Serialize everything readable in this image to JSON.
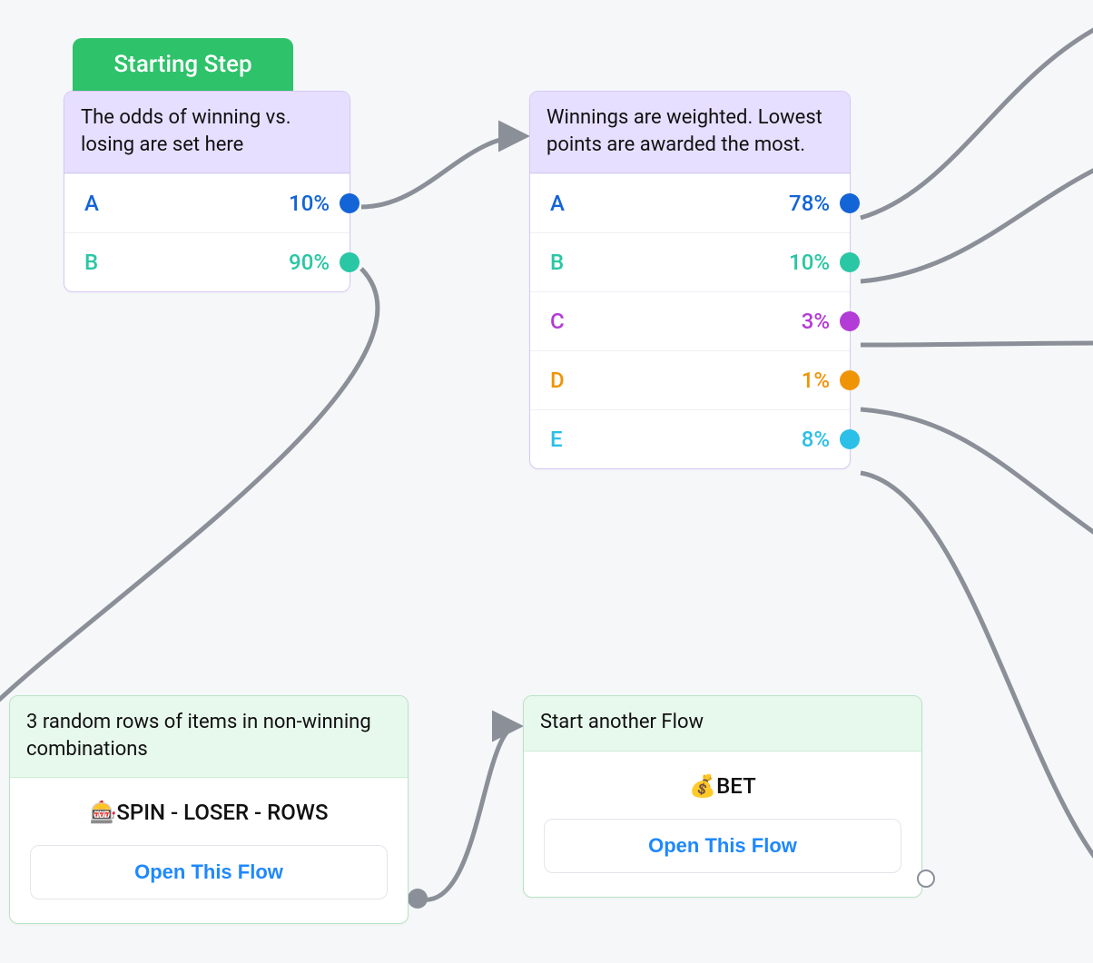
{
  "starting_tab": "Starting Step",
  "node1": {
    "header": "The odds of winning vs. losing are set here",
    "rows": [
      {
        "label": "A",
        "value": "10%",
        "color": "#1364d6"
      },
      {
        "label": "B",
        "value": "90%",
        "color": "#29c7a4"
      }
    ]
  },
  "node2": {
    "header": "Winnings are weighted. Lowest points are awarded the most.",
    "rows": [
      {
        "label": "A",
        "value": "78%",
        "color": "#1364d6"
      },
      {
        "label": "B",
        "value": "10%",
        "color": "#29c7a4"
      },
      {
        "label": "C",
        "value": "3%",
        "color": "#b33bd6"
      },
      {
        "label": "D",
        "value": "1%",
        "color": "#f09407"
      },
      {
        "label": "E",
        "value": "8%",
        "color": "#2cbfe8"
      }
    ]
  },
  "node3": {
    "header": "3 random rows of items in non-winning combinations",
    "flow_icon": "🎰",
    "flow_name": "SPIN - LOSER - ROWS",
    "button": "Open This Flow"
  },
  "node4": {
    "header": "Start another Flow",
    "flow_icon": "💰",
    "flow_name": "BET",
    "button": "Open This Flow"
  },
  "colors": {
    "connector": "#8a8f98",
    "purple_border": "#d7c8f7",
    "green_border": "#b6e4c5"
  }
}
